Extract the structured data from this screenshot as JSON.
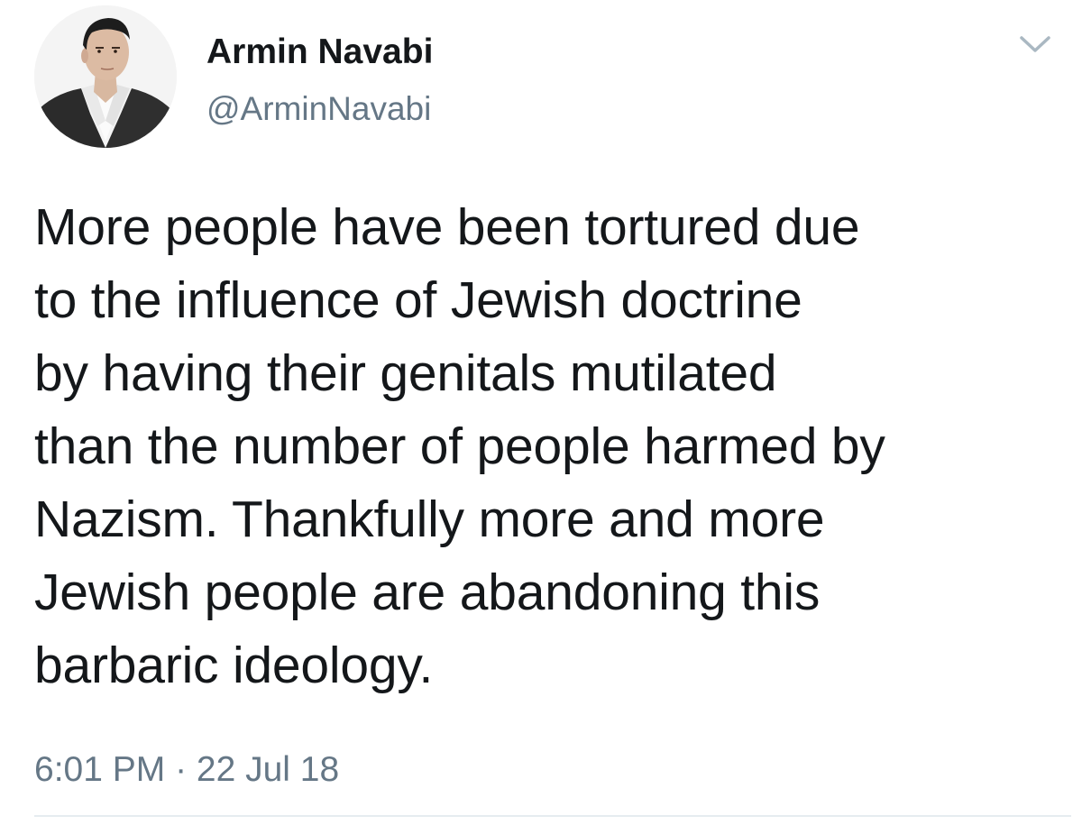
{
  "user": {
    "display_name": "Armin Navabi",
    "handle": "@ArminNavabi"
  },
  "tweet": {
    "lines": [
      "More people have been tortured due",
      "to the influence of Jewish doctrine",
      "by having their genitals mutilated",
      "than the number of people harmed by",
      "Nazism. Thankfully more and more",
      "Jewish people are abandoning this",
      "barbaric ideology."
    ],
    "timestamp": "6:01 PM · 22 Jul 18"
  },
  "icons": {
    "menu": "chevron-down-icon",
    "avatar": "profile-photo"
  },
  "colors": {
    "text": "#14171a",
    "secondary_text": "#657786",
    "caret": "#aab8c2",
    "background": "#ffffff"
  }
}
